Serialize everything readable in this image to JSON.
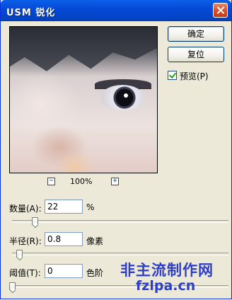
{
  "window": {
    "title": "USM 锐化",
    "close_icon": "close-icon"
  },
  "preview": {
    "zoom_out_label": "−",
    "zoom_in_label": "+",
    "zoom_level": "100%"
  },
  "buttons": {
    "ok_label": "确定",
    "reset_label": "复位"
  },
  "preview_toggle": {
    "label": "预览(P)",
    "checked": true
  },
  "fields": {
    "amount": {
      "label": "数量(A):",
      "value": "22",
      "unit": "%",
      "slider_fraction": 0.05
    },
    "radius": {
      "label": "半径(R):",
      "value": "0.8",
      "unit": "像素",
      "slider_fraction": 0.03
    },
    "threshold": {
      "label": "阈值(T):",
      "value": "0",
      "unit": "色阶",
      "slider_fraction": 0.0
    }
  },
  "watermark": {
    "line1": "非主流制作网",
    "line2": "fzlpa.cn"
  }
}
